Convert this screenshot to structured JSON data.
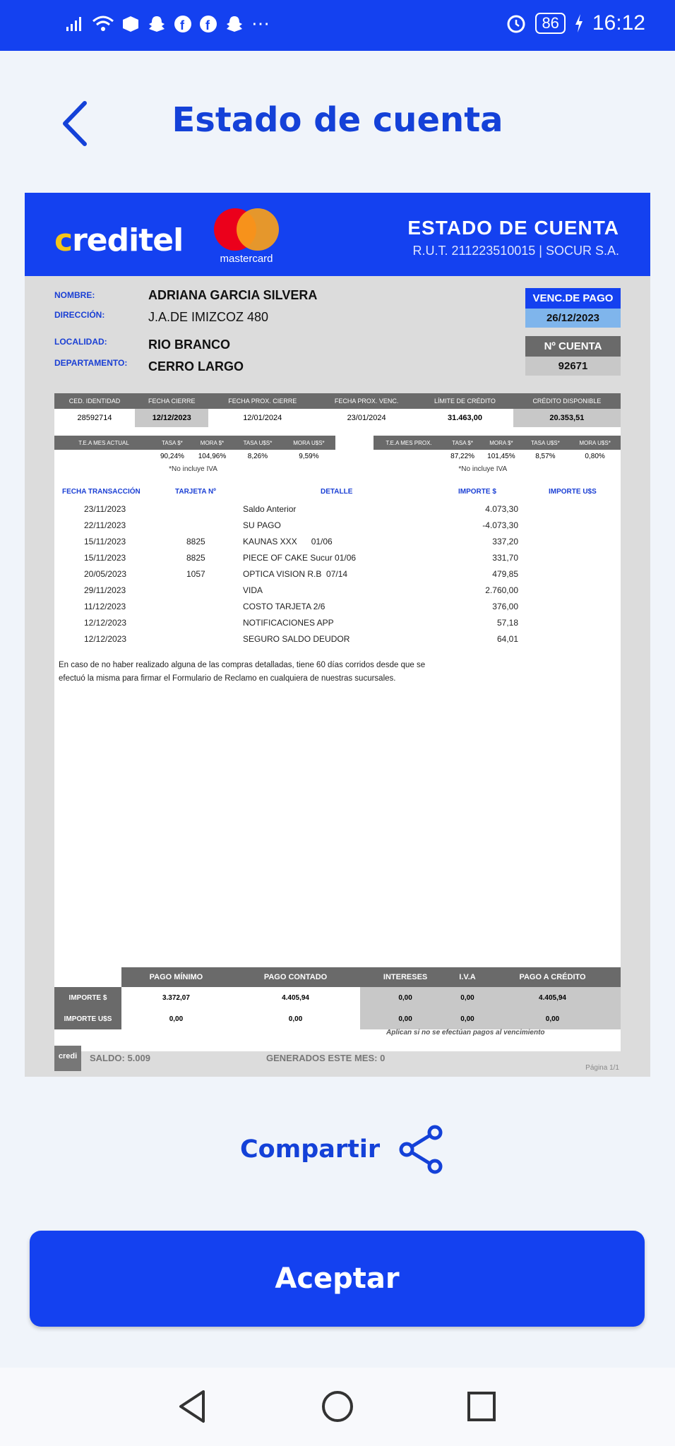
{
  "status": {
    "icons": [
      "signal-icon",
      "wifi-icon",
      "box-icon",
      "snapchat-icon",
      "facebook-icon",
      "facebook-icon",
      "snapchat-icon",
      "more-icon"
    ],
    "battery": "86",
    "time": "16:12"
  },
  "header": {
    "title": "Estado de cuenta"
  },
  "doc": {
    "brand": "creditel",
    "mc_label": "mastercard",
    "ec_title": "ESTADO DE CUENTA",
    "rut": "R.U.T. 211223510015 | SOCUR S.A.",
    "labels": {
      "nombre": "NOMBRE:",
      "direccion": "DIRECCIÓN:",
      "localidad": "LOCALIDAD:",
      "departamento": "DEPARTAMENTO:"
    },
    "values": {
      "nombre": "ADRIANA GARCIA SILVERA",
      "direccion": "J.A.DE IMIZCOZ 480",
      "localidad": "RIO BRANCO",
      "departamento": "CERRO LARGO"
    },
    "venc_label": "VENC.DE PAGO",
    "venc_value": "26/12/2023",
    "cuenta_label": "Nº CUENTA",
    "cuenta_value": "92671",
    "info_headers": [
      "CED. IDENTIDAD",
      "FECHA CIERRE",
      "FECHA PROX. CIERRE",
      "FECHA PROX. VENC.",
      "LÍMITE DE CRÉDITO",
      "CRÉDITO DISPONIBLE"
    ],
    "info_values": [
      "28592714",
      "12/12/2023",
      "12/01/2024",
      "23/01/2024",
      "31.463,00",
      "20.353,51"
    ],
    "tea_actual": {
      "headers": [
        "T.E.A MES ACTUAL",
        "TASA $*",
        "MORA $*",
        "TASA U$S*",
        "MORA U$S*"
      ],
      "values": [
        "",
        "90,24%",
        "104,96%",
        "8,26%",
        "9,59%"
      ],
      "note": "*No incluye IVA"
    },
    "tea_prox": {
      "headers": [
        "T.E.A MES PROX.",
        "TASA $*",
        "MORA $*",
        "TASA U$S*",
        "MORA U$S*"
      ],
      "values": [
        "",
        "87,22%",
        "101,45%",
        "8,57%",
        "0,80%"
      ],
      "note": "*No incluye IVA"
    },
    "tx_headers": {
      "fecha": "FECHA TRANSACCIÓN",
      "tarjeta": "TARJETA Nº",
      "detalle": "DETALLE",
      "importe": "IMPORTE $",
      "importe_us": "IMPORTE U$S"
    },
    "transactions": [
      {
        "fecha": "23/11/2023",
        "tarjeta": "",
        "detalle": "Saldo Anterior",
        "importe": "4.073,30"
      },
      {
        "fecha": "22/11/2023",
        "tarjeta": "",
        "detalle": "SU PAGO",
        "importe": "-4.073,30"
      },
      {
        "fecha": "15/11/2023",
        "tarjeta": "8825",
        "detalle": "KAUNAS XXX      01/06",
        "importe": "337,20"
      },
      {
        "fecha": "15/11/2023",
        "tarjeta": "8825",
        "detalle": "PIECE OF CAKE Sucur 01/06",
        "importe": "331,70"
      },
      {
        "fecha": "20/05/2023",
        "tarjeta": "1057",
        "detalle": "OPTICA VISION R.B  07/14",
        "importe": "479,85"
      },
      {
        "fecha": "29/11/2023",
        "tarjeta": "",
        "detalle": "VIDA",
        "importe": "2.760,00"
      },
      {
        "fecha": "11/12/2023",
        "tarjeta": "",
        "detalle": "COSTO TARJETA 2/6",
        "importe": "376,00"
      },
      {
        "fecha": "12/12/2023",
        "tarjeta": "",
        "detalle": "NOTIFICACIONES APP",
        "importe": "57,18"
      },
      {
        "fecha": "12/12/2023",
        "tarjeta": "",
        "detalle": "SEGURO SALDO DEUDOR",
        "importe": "64,01"
      }
    ],
    "disclaimer": "En caso de no haber realizado alguna de las compras detalladas, tiene 60 días corridos desde que se efectuó la misma para firmar el Formulario de Reclamo en cualquiera de nuestras sucursales.",
    "summary": {
      "headers": [
        "PAGO MÍNIMO",
        "PAGO CONTADO",
        "INTERESES",
        "I.V.A",
        "PAGO A CRÉDITO"
      ],
      "rows": [
        {
          "label": "IMPORTE $",
          "values": [
            "3.372,07",
            "4.405,94",
            "0,00",
            "0,00",
            "4.405,94"
          ]
        },
        {
          "label": "IMPORTE U$S",
          "values": [
            "0,00",
            "0,00",
            "0,00",
            "0,00",
            "0,00"
          ]
        }
      ],
      "note": "Aplican si no se efectúan pagos al vencimiento"
    },
    "footer": {
      "logo": "credi",
      "saldo": "SALDO: 5.009",
      "generados": "GENERADOS ESTE MES: 0",
      "pagina": "Página 1/1"
    }
  },
  "share": {
    "label": "Compartir"
  },
  "accept": {
    "label": "Aceptar"
  },
  "colors": {
    "primary": "#1441f0",
    "background": "#f0f4fa"
  }
}
